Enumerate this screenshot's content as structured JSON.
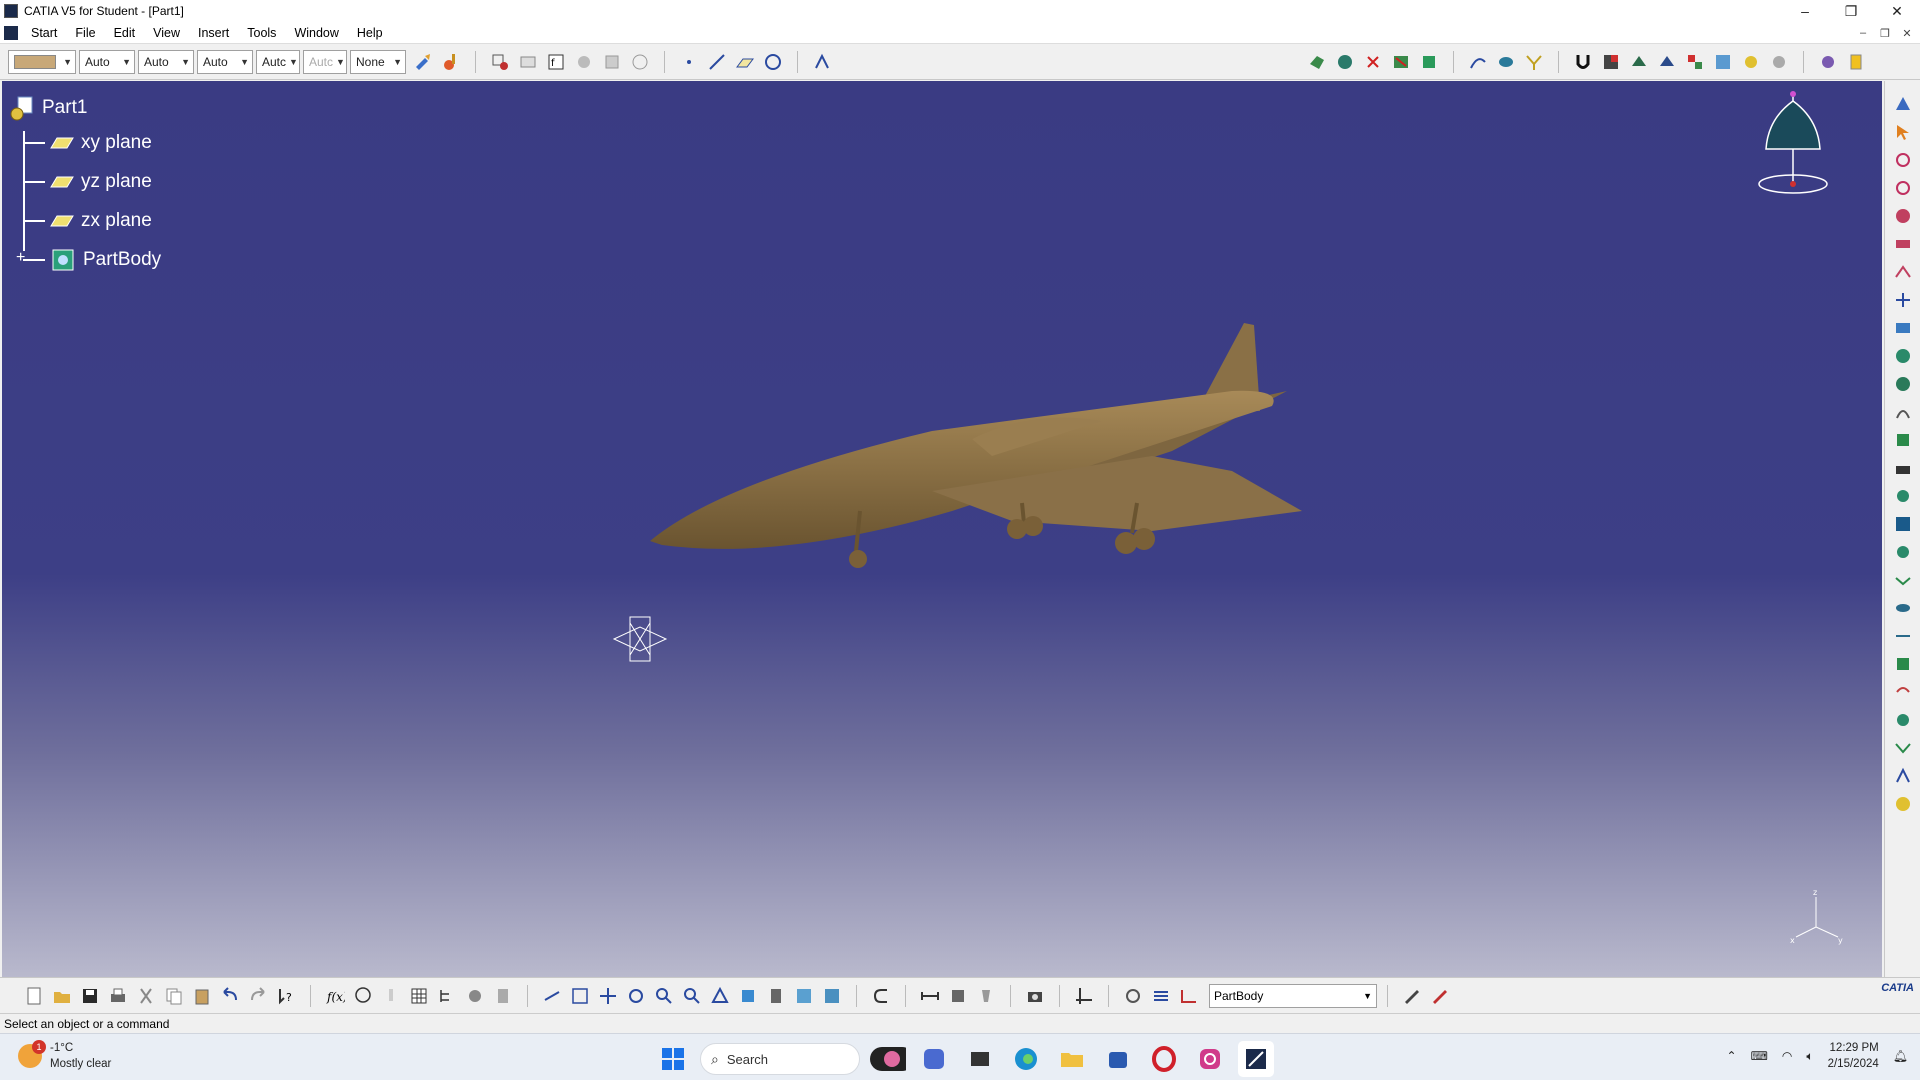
{
  "window": {
    "title": "CATIA V5 for Student - [Part1]",
    "minimize": "–",
    "restore": "❐",
    "close": "✕"
  },
  "menu": {
    "items": [
      {
        "label": "Start"
      },
      {
        "label": "File"
      },
      {
        "label": "Edit"
      },
      {
        "label": "View"
      },
      {
        "label": "Insert"
      },
      {
        "label": "Tools"
      },
      {
        "label": "Window"
      },
      {
        "label": "Help"
      }
    ],
    "mdi_min": "–",
    "mdi_restore": "❐",
    "mdi_close": "✕"
  },
  "toolbar_top": {
    "color_value": "#c8a878",
    "combos": [
      "Auto",
      "Auto",
      "Auto",
      "Autc",
      "Autc"
    ],
    "layer_value": "None"
  },
  "tree": {
    "root": "Part1",
    "items": [
      {
        "label": "xy plane"
      },
      {
        "label": "yz plane"
      },
      {
        "label": "zx plane"
      },
      {
        "label": "PartBody"
      }
    ],
    "expand_symbol": "+"
  },
  "toolbar_bottom": {
    "current_body": "PartBody",
    "logo": "CATIA"
  },
  "status": {
    "message": "Select an object or a command"
  },
  "taskbar": {
    "weather_badge": "1",
    "temperature": "-1°C",
    "weather_desc": "Mostly clear",
    "search_placeholder": "Search",
    "time": "12:29 PM",
    "date": "2/15/2024"
  },
  "colors": {
    "viewport_top": "#3a3b83",
    "viewport_bottom": "#b9b9cd",
    "model": "#8a7248",
    "accent": "#1a3b8a"
  }
}
